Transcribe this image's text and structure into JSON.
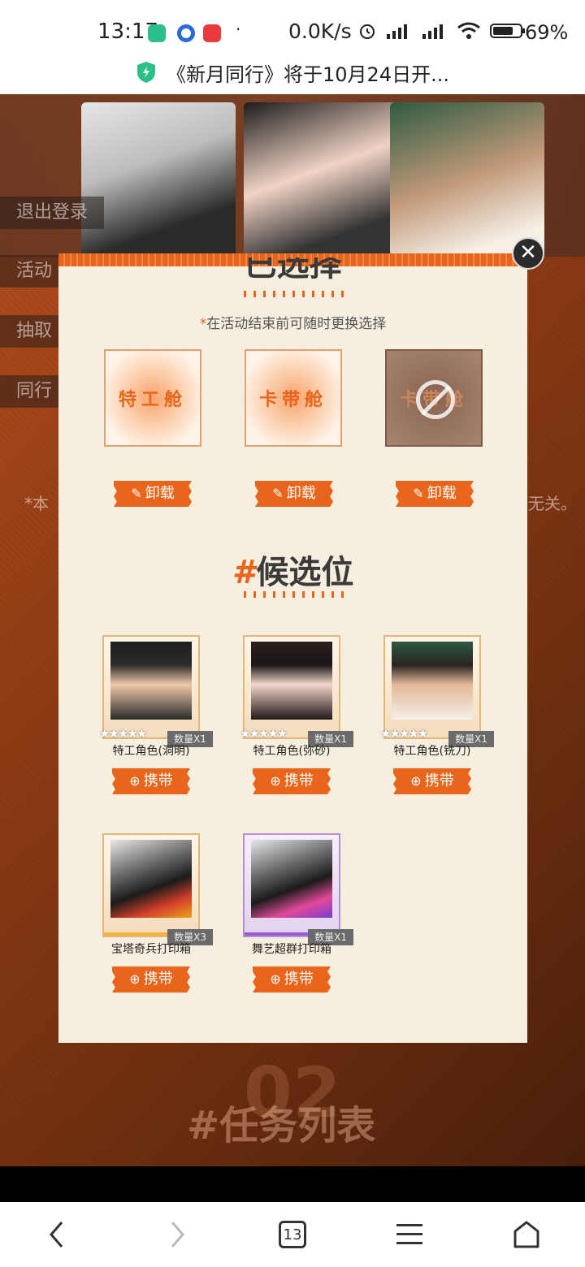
{
  "status_bar": {
    "time": "13:17",
    "dot": "·",
    "net_speed": "0.0K/s",
    "battery": "69%"
  },
  "notification": {
    "text": "《新月同行》将于10月24日开..."
  },
  "background": {
    "side_buttons": [
      "退出登录",
      "活动",
      "抽取",
      "同行"
    ],
    "note_left": "*本",
    "note_right": "无关。",
    "section_number": "02",
    "section_title": "#任务列表"
  },
  "modal": {
    "top_title": "已选择",
    "hint_star": "*",
    "hint": "在活动结束前可随时更换选择",
    "slots": [
      {
        "label": "特工舱",
        "disabled": false
      },
      {
        "label": "卡带舱",
        "disabled": false
      },
      {
        "label": "卡带舱",
        "disabled": true
      }
    ],
    "unload_label": "卸载",
    "candidates_title_hash": "#",
    "candidates_title": "候选位",
    "candidates": [
      {
        "name": "特工角色(洞明)",
        "qty": "数量X1",
        "rarity_stars": "★★★★★"
      },
      {
        "name": "特工角色(弥砂)",
        "qty": "数量X1",
        "rarity_stars": "★★★★★"
      },
      {
        "name": "特工角色(铣刀)",
        "qty": "数量X1",
        "rarity_stars": "★★★★★"
      },
      {
        "name": "宝塔奇兵打印箱",
        "qty": "数量X3",
        "rarity_stars": ""
      },
      {
        "name": "舞艺超群打印箱",
        "qty": "数量X1",
        "rarity_stars": ""
      }
    ],
    "carry_label": "携带",
    "close_symbol": "✕"
  },
  "bottom_nav": {
    "tab_count": "13"
  },
  "colors": {
    "accent": "#e8651b",
    "modal_bg": "#f6efe0",
    "rarity_gold": "#f3b33a",
    "rarity_purple": "#9b5ad1"
  }
}
